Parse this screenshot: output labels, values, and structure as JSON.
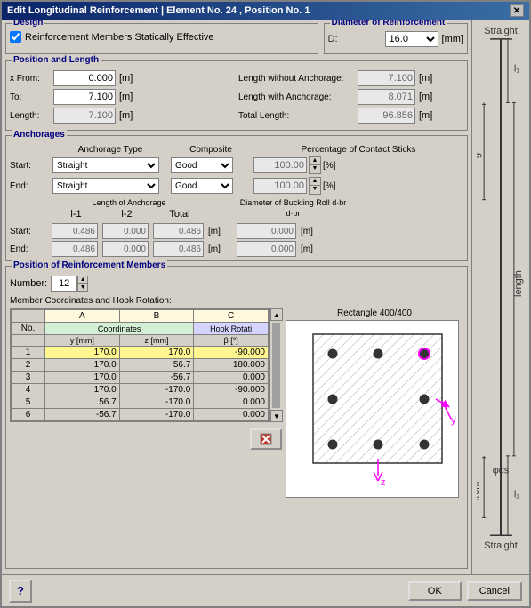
{
  "window": {
    "title": "Edit Longitudinal Reinforcement  |  Element No. 24 , Position No. 1",
    "close": "✕"
  },
  "design": {
    "section_title": "Design",
    "checkbox_label": "Reinforcement Members Statically Effective",
    "checkbox_checked": true
  },
  "diameter": {
    "section_title": "Diameter of Reinforcement",
    "d_label": "D:",
    "d_value": "16.0",
    "d_unit": "[mm]"
  },
  "position_length": {
    "section_title": "Position and Length",
    "x_from_label": "x From:",
    "x_from_value": "0.000",
    "x_from_unit": "[m]",
    "to_label": "To:",
    "to_value": "7.100",
    "to_unit": "[m]",
    "length_label": "Length:",
    "length_value": "7.100",
    "length_unit": "[m]",
    "without_label": "Length without Anchorage:",
    "without_value": "7.100",
    "without_unit": "[m]",
    "with_label": "Length with Anchorage:",
    "with_value": "8.071",
    "with_unit": "[m]",
    "total_label": "Total Length:",
    "total_value": "96.856",
    "total_unit": "[m]"
  },
  "anchorages": {
    "section_title": "Anchorages",
    "type_header": "Anchorage Type",
    "composite_header": "Composite",
    "contact_header": "Percentage of Contact Sticks",
    "start_label": "Start:",
    "end_label": "End:",
    "start_type": "Straight",
    "end_type": "Straight",
    "start_composite": "Good",
    "end_composite": "Good",
    "start_contact": "100.00",
    "end_contact": "100.00",
    "contact_unit": "[%]",
    "length_header": "Length of Anchorage",
    "buckling_header": "Diameter of Buckling Roll d·br",
    "l1_header": "l-1",
    "l2_header": "l-2",
    "total_header": "Total",
    "start_l1": "0.486",
    "start_l2": "0.000",
    "start_total": "0.486",
    "start_m": "[m]",
    "start_dbr": "0.000",
    "start_dbr_m": "[m]",
    "end_l1": "0.486",
    "end_l2": "0.000",
    "end_total": "0.486",
    "end_m": "[m]",
    "end_dbr": "0.000",
    "end_dbr_m": "[m]"
  },
  "position_members": {
    "section_title": "Position of Reinforcement Members",
    "number_label": "Number:",
    "number_value": "12",
    "coords_label": "Member Coordinates and Hook Rotation:",
    "col_a": "A",
    "col_b": "B",
    "col_c": "C",
    "coord_header": "Coordinates",
    "hook_header": "Hook Rotati",
    "y_header": "y [mm]",
    "z_header": "z [mm]",
    "beta_header": "β [°]",
    "rows": [
      {
        "no": "1",
        "y": "170.0",
        "z": "170.0",
        "beta": "-90.000",
        "selected": true
      },
      {
        "no": "2",
        "y": "170.0",
        "z": "56.7",
        "beta": "180.000",
        "selected": false
      },
      {
        "no": "3",
        "y": "170.0",
        "z": "-56.7",
        "beta": "0.000",
        "selected": false
      },
      {
        "no": "4",
        "y": "170.0",
        "z": "-170.0",
        "beta": "-90.000",
        "selected": false
      },
      {
        "no": "5",
        "y": "56.7",
        "z": "-170.0",
        "beta": "0.000",
        "selected": false
      },
      {
        "no": "6",
        "y": "-56.7",
        "z": "-170.0",
        "beta": "0.000",
        "selected": false
      }
    ],
    "cross_title": "Rectangle 400/400",
    "delete_label": "✕"
  },
  "bottom": {
    "help_label": "?",
    "ok_label": "OK",
    "cancel_label": "Cancel"
  },
  "right_diagram": {
    "top_label": "Straight",
    "bottom_label": "Straight",
    "l1_label": "l₁",
    "g_label": "g",
    "length_label": "length",
    "ds_label": "φds",
    "from_label": "from",
    "l1b_label": "l₁"
  }
}
